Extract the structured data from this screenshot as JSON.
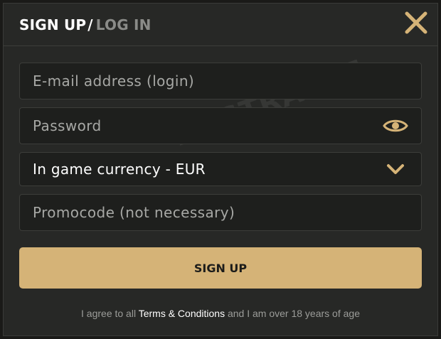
{
  "header": {
    "signup_tab": "SIGN UP",
    "separator": "/",
    "login_tab": "LOG IN",
    "close_icon": "close-icon"
  },
  "form": {
    "email_placeholder": "E-mail address (login)",
    "email_value": "",
    "password_placeholder": "Password",
    "password_value": "",
    "password_toggle_icon": "eye-icon",
    "currency_selected": "In game currency - EUR",
    "currency_icon": "chevron-down-icon",
    "promo_placeholder": "Promocode (not necessary)",
    "promo_value": ""
  },
  "watermark": "NOSTRABET",
  "actions": {
    "signup_label": "SIGN UP"
  },
  "terms": {
    "prefix": "I agree to all ",
    "link": "Terms & Conditions",
    "suffix": " and I am over 18 years of age"
  },
  "colors": {
    "accent": "#d5b377",
    "panel": "#272826",
    "field": "#1e1f1d"
  }
}
